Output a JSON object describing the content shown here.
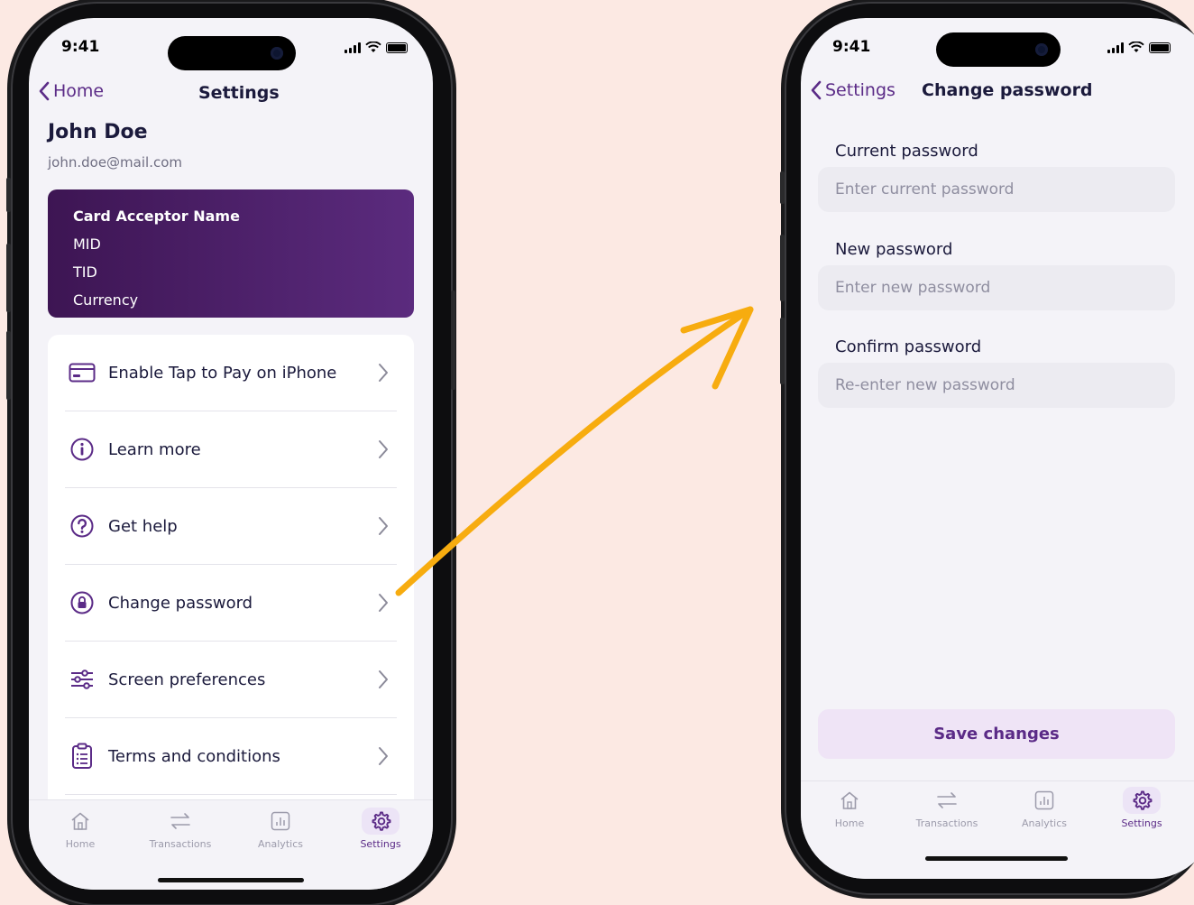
{
  "colors": {
    "background": "#fce9e3",
    "accent": "#5b2b87",
    "arrow": "#f7ac0f",
    "card_start": "#3d1553",
    "card_end": "#5b2b7e"
  },
  "settings_screen": {
    "status_time": "9:41",
    "back_label": "Home",
    "title": "Settings",
    "user_name": "John Doe",
    "user_email": "john.doe@mail.com",
    "card": {
      "name": "Card Acceptor Name",
      "mid": "MID",
      "tid": "TID",
      "currency": "Currency"
    },
    "menu": [
      {
        "label": "Enable Tap to Pay on iPhone",
        "icon": "credit-card-icon"
      },
      {
        "label": "Learn more",
        "icon": "info-icon"
      },
      {
        "label": "Get help",
        "icon": "help-icon"
      },
      {
        "label": "Change password",
        "icon": "lock-icon"
      },
      {
        "label": "Screen preferences",
        "icon": "sliders-icon"
      },
      {
        "label": "Terms and conditions",
        "icon": "clipboard-icon"
      }
    ],
    "tabs": [
      "Home",
      "Transactions",
      "Analytics",
      "Settings"
    ],
    "active_tab": "Settings"
  },
  "password_screen": {
    "status_time": "9:41",
    "back_label": "Settings",
    "title": "Change password",
    "fields": [
      {
        "label": "Current password",
        "placeholder": "Enter current password"
      },
      {
        "label": "New password",
        "placeholder": "Enter new password"
      },
      {
        "label": "Confirm password",
        "placeholder": "Re-enter new password"
      }
    ],
    "save_label": "Save changes",
    "tabs": [
      "Home",
      "Transactions",
      "Analytics",
      "Settings"
    ],
    "active_tab": "Settings"
  }
}
